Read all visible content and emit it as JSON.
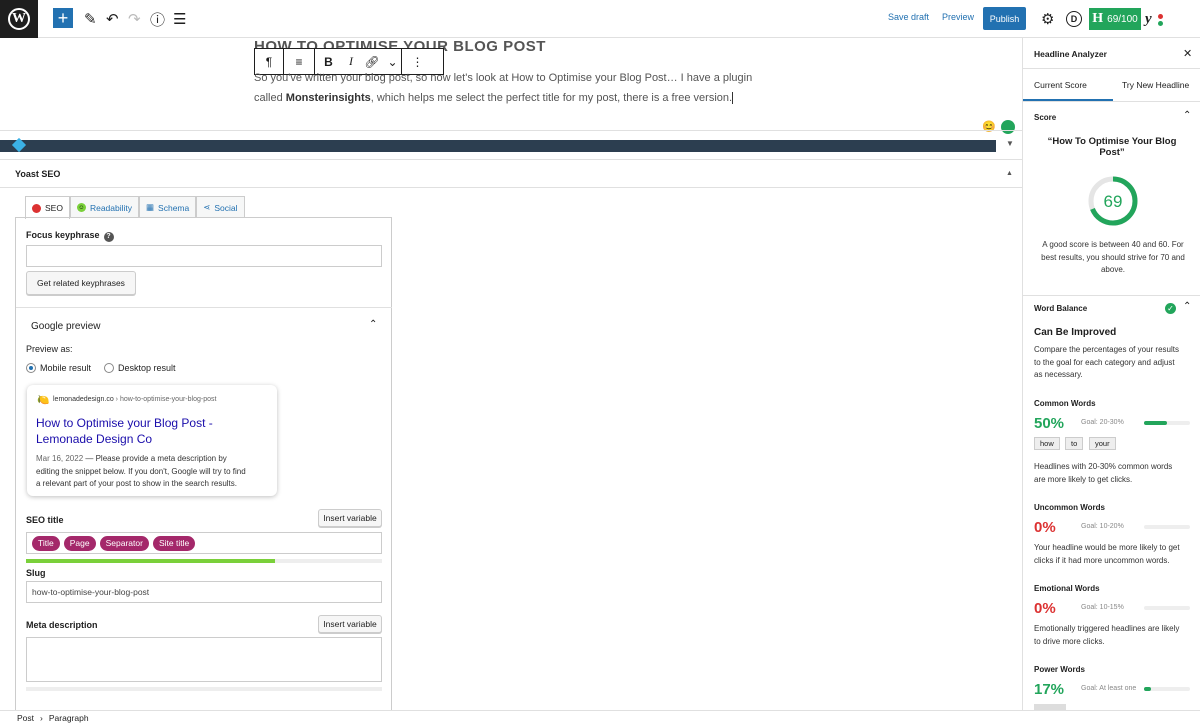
{
  "topbar": {
    "save_draft": "Save draft",
    "preview": "Preview",
    "publish": "Publish",
    "score_letter": "H",
    "score_text": "69/100",
    "icons": [
      "wordpress-logo-icon",
      "plus-icon",
      "pencil-icon",
      "undo-icon",
      "redo-icon",
      "info-icon",
      "list-view-icon",
      "gear-icon",
      "d-avatar-icon",
      "yoast-icon"
    ]
  },
  "editor": {
    "title": "HOW TO OPTIMISE YOUR BLOG POST",
    "para1": "So you've written your blog post, so now let's look at How to Optimise your Blog Post… I have a plugin",
    "para2_prefix": "called ",
    "para2_bold": "Monsterinsights",
    "para2_suffix": ", which helps me select the perfect title for my post, there is a free version.",
    "toolbar": {
      "para": "¶",
      "bold": "B",
      "italic": "I",
      "more": "⋮"
    }
  },
  "yoast": {
    "heading": "Yoast SEO",
    "tabs": [
      "SEO",
      "Readability",
      "Schema",
      "Social"
    ],
    "focus_label": "Focus keyphrase",
    "related_btn": "Get related keyphrases",
    "google_preview": "Google preview",
    "preview_as": "Preview as:",
    "mobile": "Mobile result",
    "desktop": "Desktop result",
    "snippet": {
      "site": "lemonadedesign.co",
      "path": " › how-to-optimise-your-blog-post",
      "title_line1": "How to Optimise your Blog Post -",
      "title_line2": "Lemonade Design Co",
      "date": "Mar 16, 2022",
      "desc1": " — Please provide a meta description by",
      "desc2": "editing the snippet below. If you don't, Google will try to find",
      "desc3": "a relevant part of your post to show in the search results."
    },
    "seo_title": "SEO title",
    "insert_variable": "Insert variable",
    "pills": [
      "Title",
      "Page",
      "Separator",
      "Site title"
    ],
    "title_progress": 0.7,
    "slug_label": "Slug",
    "slug_value": "how-to-optimise-your-blog-post",
    "meta_label": "Meta description"
  },
  "sidebar": {
    "title": "Headline Analyzer",
    "tab_current": "Current Score",
    "tab_try": "Try New Headline",
    "score_label": "Score",
    "headline": "“How To Optimise Your Blog Post”",
    "score_value": "69",
    "score_fraction": 0.69,
    "score_note1": "A good score is between 40 and 60. For",
    "score_note2": "best results, you should strive for 70 and",
    "score_note3": "above.",
    "word_balance": "Word Balance",
    "can_improve": "Can Be Improved",
    "wb_note1": "Compare the percentages of your results",
    "wb_note2": "to the goal for each category and adjust",
    "wb_note3": "as necessary.",
    "common": {
      "label": "Common Words",
      "pct": "50%",
      "goal": "Goal: 20-30%",
      "fill": 0.5,
      "chips": [
        "how",
        "to",
        "your"
      ],
      "note1": "Headlines with 20-30% common words",
      "note2": "are more likely to get clicks."
    },
    "uncommon": {
      "label": "Uncommon Words",
      "pct": "0%",
      "goal": "Goal: 10-20%",
      "fill": 0,
      "note1": "Your headline would be more likely to get",
      "note2": "clicks if it had more uncommon words."
    },
    "emotional": {
      "label": "Emotional Words",
      "pct": "0%",
      "goal": "Goal: 10-15%",
      "fill": 0,
      "note1": "Emotionally triggered headlines are likely",
      "note2": "to drive more clicks."
    },
    "power": {
      "label": "Power Words",
      "pct": "17%",
      "goal": "Goal: At least one",
      "fill": 0.15
    },
    "colors": {
      "green": "#22a55b",
      "red": "#dc3232"
    }
  },
  "status": {
    "post": "Post",
    "sep": "›",
    "block": "Paragraph"
  }
}
